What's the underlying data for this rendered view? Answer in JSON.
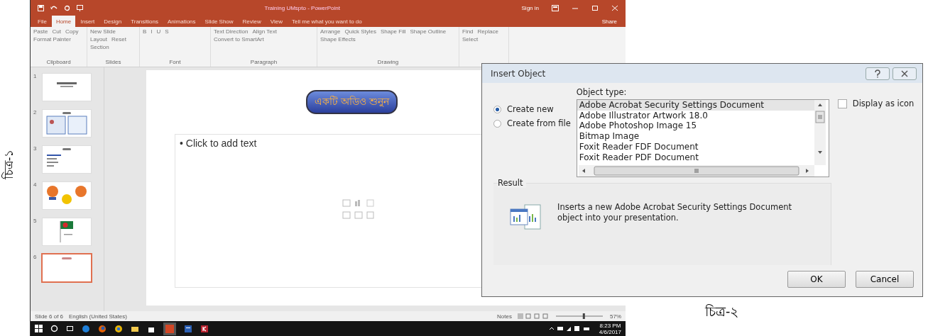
{
  "captions": [
    {
      "text": "চিত্র-১"
    },
    {
      "text": "চিত্র-২"
    }
  ],
  "powerpoint": {
    "title": "Training UMspto - PowerPoint",
    "account": "Sign in",
    "share": "Share",
    "tell_me": "Tell me what you want to do",
    "tabs": [
      {
        "label": "File",
        "selected": false
      },
      {
        "label": "Home",
        "selected": true
      },
      {
        "label": "Insert",
        "selected": false
      },
      {
        "label": "Design",
        "selected": false
      },
      {
        "label": "Transitions",
        "selected": false
      },
      {
        "label": "Animations",
        "selected": false
      },
      {
        "label": "Slide Show",
        "selected": false
      },
      {
        "label": "Review",
        "selected": false
      },
      {
        "label": "View",
        "selected": false
      }
    ],
    "ribbon_groups": [
      {
        "label": "Clipboard",
        "buttons": [
          "Paste",
          "Cut",
          "Copy",
          "Format Painter"
        ]
      },
      {
        "label": "Slides",
        "buttons": [
          "New Slide",
          "Layout",
          "Reset",
          "Section"
        ]
      },
      {
        "label": "Font",
        "buttons": [
          "B",
          "I",
          "U",
          "S"
        ]
      },
      {
        "label": "Paragraph",
        "buttons": [
          "Text Direction",
          "Align Text",
          "Convert to SmartArt"
        ]
      },
      {
        "label": "Drawing",
        "buttons": [
          "Arrange",
          "Quick Styles",
          "Shape Fill",
          "Shape Outline",
          "Shape Effects"
        ]
      },
      {
        "buttons": [
          "Find",
          "Replace",
          "Select"
        ]
      }
    ],
    "slides": [
      {
        "number": "1",
        "kind": "title",
        "selected": false
      },
      {
        "number": "2",
        "kind": "images",
        "selected": false
      },
      {
        "number": "3",
        "kind": "text",
        "selected": false
      },
      {
        "number": "4",
        "kind": "figures",
        "selected": false
      },
      {
        "number": "5",
        "kind": "flag",
        "selected": false
      },
      {
        "number": "6",
        "kind": "blank",
        "selected": true
      }
    ],
    "slide": {
      "title": "একটি অডিও শুনুন",
      "placeholder": "• Click to add text"
    },
    "status_bar": {
      "slide_info": "Slide 6 of 6",
      "language": "English (United States)",
      "notes": "Notes",
      "zoom_slider": {
        "level": 0.6
      },
      "zoom": "57%"
    },
    "taskbar": {
      "time": "8:23 PM",
      "date": "4/6/2017"
    }
  },
  "dialog": {
    "title": "Insert Object",
    "options": [
      {
        "label": "Create new",
        "selected": true
      },
      {
        "label": "Create from file",
        "selected": false
      }
    ],
    "object_type_label": "Object type:",
    "object_types": [
      {
        "label": "Adobe Acrobat Security Settings Document",
        "selected": true
      },
      {
        "label": "Adobe Illustrator Artwork 18.0",
        "selected": false
      },
      {
        "label": "Adobe Photoshop Image 15",
        "selected": false
      },
      {
        "label": "Bitmap Image",
        "selected": false
      },
      {
        "label": "Foxit Reader FDF Document",
        "selected": false
      },
      {
        "label": "Foxit Reader PDF Document",
        "selected": false
      }
    ],
    "display_as_icon": {
      "label": "Display as icon",
      "checked": false
    },
    "result_label": "Result",
    "result_text": "Inserts a new Adobe Acrobat Security Settings Document object into your presentation.",
    "buttons": [
      "OK",
      "Cancel"
    ]
  }
}
